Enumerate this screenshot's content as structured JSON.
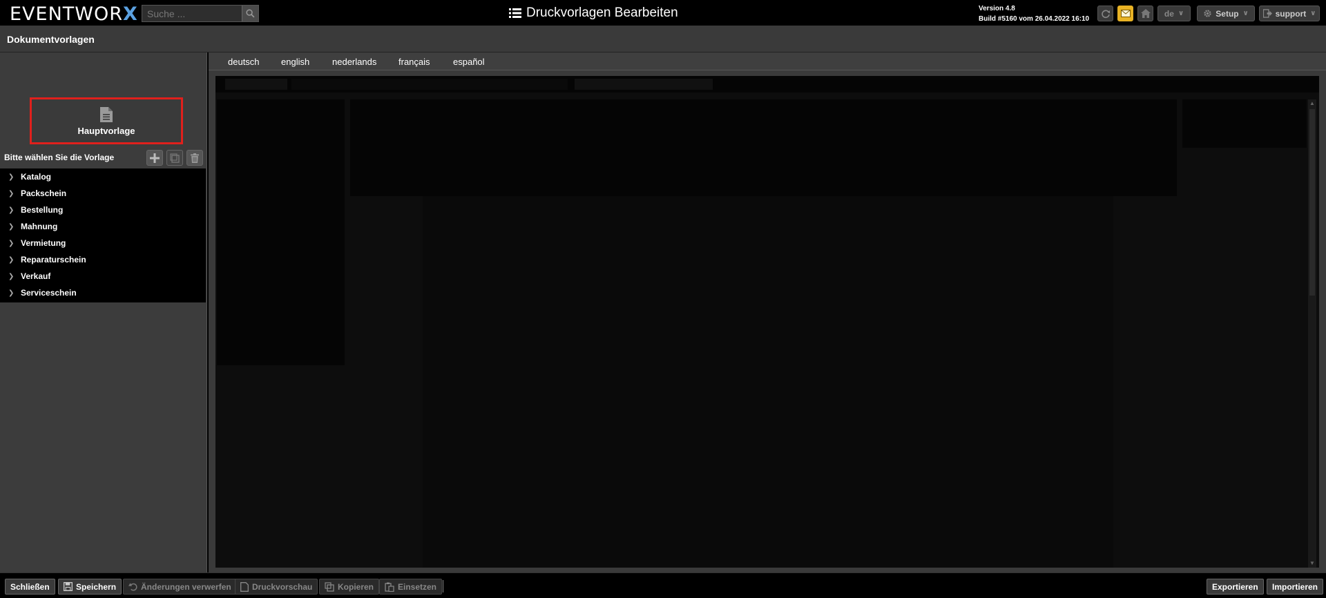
{
  "app": {
    "logo_text": "EVENTWOR",
    "logo_accent": "X",
    "logo_accent_color": "#5aa0e0",
    "search_placeholder": "Suche ...",
    "page_title": "Druckvorlagen Bearbeiten",
    "version": "Version 4.8",
    "build": "Build #5160 vom 26.04.2022 16:10",
    "lang_select": "de",
    "setup_label": "Setup",
    "user_label": "support"
  },
  "section": {
    "title": "Dokumentvorlagen"
  },
  "sidebar": {
    "main_template_label": "Hauptvorlage",
    "choose_label": "Bitte wählen Sie die Vorlage",
    "tree": [
      {
        "label": "Katalog"
      },
      {
        "label": "Packschein"
      },
      {
        "label": "Bestellung"
      },
      {
        "label": "Mahnung"
      },
      {
        "label": "Vermietung"
      },
      {
        "label": "Reparaturschein"
      },
      {
        "label": "Verkauf"
      },
      {
        "label": "Serviceschein"
      }
    ]
  },
  "languages": [
    "deutsch",
    "english",
    "nederlands",
    "français",
    "español"
  ],
  "toolbar": {
    "close": "Schließen",
    "save": "Speichern",
    "discard": "Änderungen verwerfen",
    "preview": "Druckvorschau",
    "copy": "Kopieren",
    "paste": "Einsetzen",
    "export": "Exportieren",
    "import": "Importieren"
  },
  "colors": {
    "highlight_border": "#e0201c",
    "mail_button": "#e8b224"
  }
}
